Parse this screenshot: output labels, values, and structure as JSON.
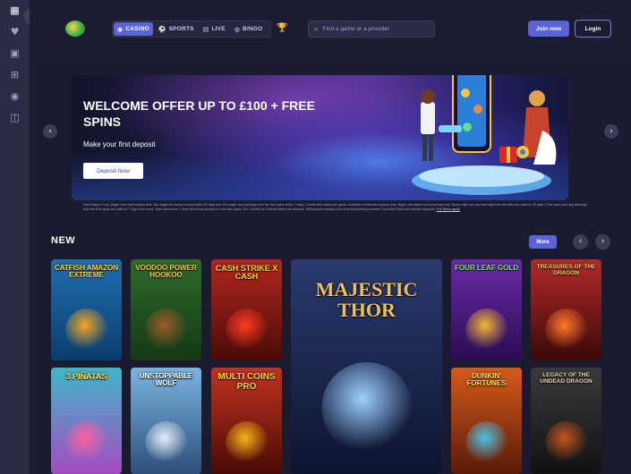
{
  "rail": {
    "toggle_icon": "chevron-right-icon",
    "icons": [
      "grid-icon",
      "heart-icon",
      "chest-icon",
      "gift-icon",
      "chip-icon",
      "chat-icon"
    ]
  },
  "header": {
    "tabs": [
      {
        "label": "CASINO",
        "icon": "casino-icon",
        "active": true
      },
      {
        "label": "SPORTS",
        "icon": "football-icon",
        "active": false
      },
      {
        "label": "LIVE",
        "icon": "live-cards-icon",
        "active": false
      },
      {
        "label": "BINGO",
        "icon": "bingo-icon",
        "active": false
      }
    ],
    "search_placeholder": "Find a game or a provider",
    "join_label": "Join now",
    "login_label": "Login"
  },
  "hero": {
    "title": "WELCOME OFFER UP TO £100 + FREE SPINS",
    "subtitle": "Make your first deposit",
    "button_label": "Deposit Now"
  },
  "terms": {
    "text": "New Players Only. Wager from real balance first. 10x wager the bonus money within 30 days and 10x wager any winnings from the free spins within 7 days. Contribution varies per game. Available on selected games only. Wager calculated on bonus bets only. Bonus offer and any winnings from the offer are valid for 30 days / Free spins and any winnings from the free spins are valid for 7 days from issue. Max conversion: 1 time the bonus amount or from free spins: £20. Limited to 5 brands within the network. Withdrawal requests void all active/pending bonuses. Excluded Skrill and Neteller deposits.",
    "link": "Full Terms apply"
  },
  "section": {
    "title": "NEW",
    "more_label": "More"
  },
  "games": [
    {
      "title": "CATFISH AMAZON EXTREME",
      "color1": "#1e6fb0",
      "color2": "#0b3d6e",
      "accent": "#f5a623",
      "text_color": "#ffd23a"
    },
    {
      "title": "VOODOO POWER HOOKOO",
      "color1": "#2f6b2a",
      "color2": "#143814",
      "accent": "#9a5a2a",
      "text_color": "#f2c94c"
    },
    {
      "title": "CASH STRIKE X CASH",
      "color1": "#b3261e",
      "color2": "#4a0b08",
      "accent": "#ff3b1f",
      "text_color": "#ffd23a"
    },
    {
      "title": "MAJESTIC THOR",
      "color1": "#2a3a6e",
      "color2": "#0d1430",
      "accent": "#9ed0ff",
      "text_color": "#f0c060"
    },
    {
      "title": "FOUR LEAF GOLD",
      "color1": "#6a2aa8",
      "color2": "#2a0c52",
      "accent": "#f2b632",
      "text_color": "#7de07a"
    },
    {
      "title": "TREASURES OF THE DRAGON",
      "color1": "#b32a2a",
      "color2": "#3a0808",
      "accent": "#ff7a2a",
      "text_color": "#ffd23a"
    },
    {
      "title": "3 PIÑATAS",
      "color1": "#3fb7c9",
      "color2": "#a44bc0",
      "accent": "#ff5fa2",
      "text_color": "#ffe14d"
    },
    {
      "title": "UNSTOPPABLE WOLF",
      "color1": "#7ab4e0",
      "color2": "#2c4f7a",
      "accent": "#e6eef8",
      "text_color": "#ffffff"
    },
    {
      "title": "MULTI COINS PRO",
      "color1": "#c2331e",
      "color2": "#4a0a06",
      "accent": "#f5b51a",
      "text_color": "#ffd23a"
    },
    {
      "title": "DUNKIN' FORTUNES",
      "color1": "#d65a1a",
      "color2": "#5a1a08",
      "accent": "#49c1e8",
      "text_color": "#ffe14d"
    },
    {
      "title": "LEGACY OF THE UNDEAD DRAGON",
      "color1": "#3a3a3a",
      "color2": "#111111",
      "accent": "#c2551a",
      "text_color": "#e9d9b0"
    }
  ]
}
